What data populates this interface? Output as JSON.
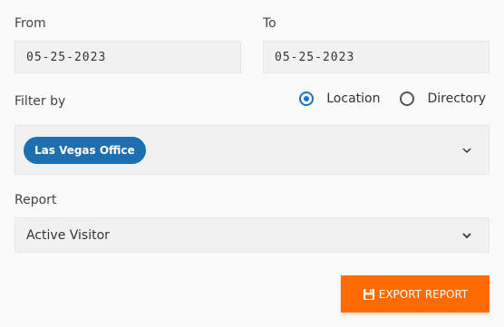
{
  "date_range": {
    "from_label": "From",
    "from_value": "05-25-2023",
    "to_label": "To",
    "to_value": "05-25-2023"
  },
  "filter": {
    "label": "Filter by",
    "options": [
      {
        "label": "Location",
        "checked": true
      },
      {
        "label": "Directory",
        "checked": false
      }
    ],
    "selected_chip": "Las Vegas Office"
  },
  "report": {
    "label": "Report",
    "selected": "Active Visitor"
  },
  "actions": {
    "export_label": "EXPORT REPORT"
  },
  "colors": {
    "accent": "#ff6b00",
    "chip": "#1e6fb0",
    "radio": "#1a73c8"
  }
}
